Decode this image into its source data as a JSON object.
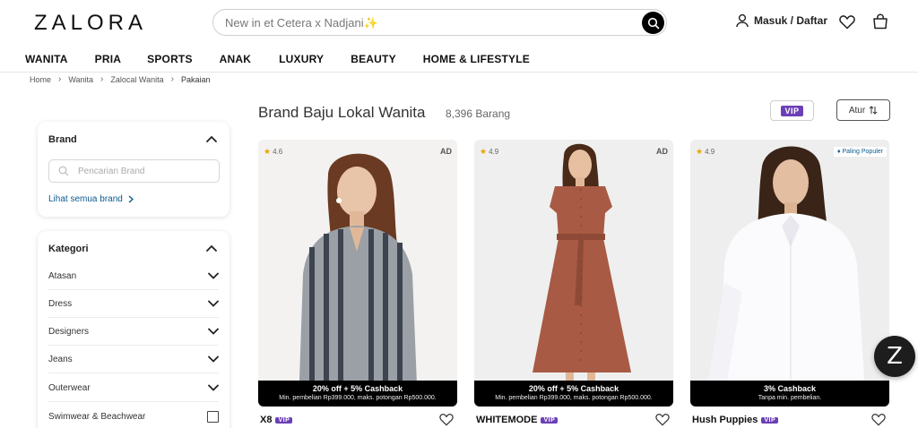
{
  "header": {
    "logo": "ZALORA",
    "search_placeholder": "New in et Cetera x Nadjani✨",
    "login_label": "Masuk / Daftar"
  },
  "nav": {
    "items": [
      "WANITA",
      "PRIA",
      "SPORTS",
      "ANAK",
      "LUXURY",
      "BEAUTY",
      "HOME & LIFESTYLE"
    ]
  },
  "breadcrumb": [
    "Home",
    "Wanita",
    "Zalocal Wanita",
    "Pakaian"
  ],
  "filters": {
    "brand": {
      "title": "Brand",
      "search_placeholder": "Pencarian Brand",
      "see_all": "Lihat semua brand"
    },
    "category": {
      "title": "Kategori",
      "items": [
        "Atasan",
        "Dress",
        "Designers",
        "Jeans",
        "Outerwear",
        "Swimwear & Beachwear"
      ]
    }
  },
  "listing": {
    "title": "Brand Baju Lokal Wanita",
    "count": "8,396 Barang",
    "vip_label": "VIP",
    "sort_label": "Atur"
  },
  "products": [
    {
      "rating": "4.6",
      "tag": "AD",
      "cashback": "20% off + 5% Cashback",
      "cashback_note": "Min. pembelian Rp399.000, maks. potongan Rp500.000.",
      "brand": "X8",
      "vip": "VIP"
    },
    {
      "rating": "4.9",
      "tag": "AD",
      "cashback": "20% off + 5% Cashback",
      "cashback_note": "Min. pembelian Rp399.000, maks. potongan Rp500.000.",
      "brand": "WHITEMODE",
      "vip": "VIP"
    },
    {
      "rating": "4.9",
      "tag": "Paling Populer",
      "cashback": "3% Cashback",
      "cashback_note": "Tanpa min. pembelian.",
      "brand": "Hush Puppies",
      "vip": "VIP"
    }
  ],
  "fab_label": "Z",
  "colors": {
    "vip": "#6b3fb5",
    "link": "#0a5a8c",
    "rating_star": "#e6a100"
  }
}
